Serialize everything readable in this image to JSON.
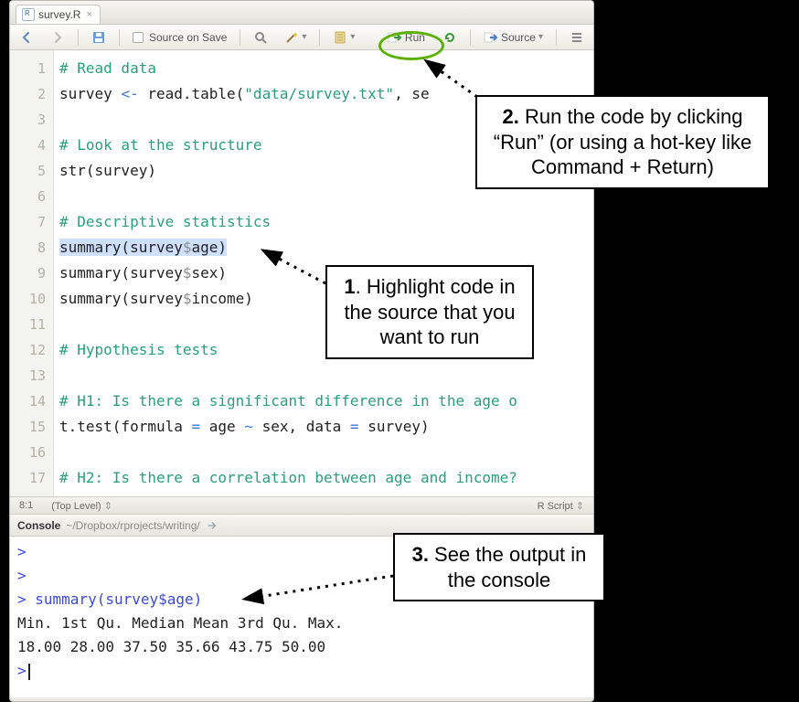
{
  "tab": {
    "filename": "survey.R"
  },
  "toolbar": {
    "source_on_save": "Source on Save",
    "run": "Run",
    "source": "Source"
  },
  "code": {
    "lines": [
      {
        "n": 1,
        "type": "comment",
        "text": "# Read data"
      },
      {
        "n": 2,
        "type": "code",
        "segments": [
          "survey ",
          {
            "op": "<-"
          },
          " read.table(",
          {
            "str": "\"data/survey.txt\""
          },
          ", se"
        ]
      },
      {
        "n": 3,
        "type": "blank"
      },
      {
        "n": 4,
        "type": "comment",
        "text": "# Look at the structure"
      },
      {
        "n": 5,
        "type": "code",
        "segments": [
          "str(survey)"
        ]
      },
      {
        "n": 6,
        "type": "blank"
      },
      {
        "n": 7,
        "type": "comment",
        "text": "# Descriptive statistics"
      },
      {
        "n": 8,
        "type": "code",
        "selected": true,
        "segments": [
          "summary(survey",
          {
            "d": "$"
          },
          "age)"
        ]
      },
      {
        "n": 9,
        "type": "code",
        "segments": [
          "summary(survey",
          {
            "d": "$"
          },
          "sex)"
        ]
      },
      {
        "n": 10,
        "type": "code",
        "segments": [
          "summary(survey",
          {
            "d": "$"
          },
          "income)"
        ]
      },
      {
        "n": 11,
        "type": "blank"
      },
      {
        "n": 12,
        "type": "comment",
        "text": "# Hypothesis tests"
      },
      {
        "n": 13,
        "type": "blank"
      },
      {
        "n": 14,
        "type": "comment",
        "text": "# H1: Is there a significant difference in the age o"
      },
      {
        "n": 15,
        "type": "code",
        "segments": [
          "t.test(formula ",
          {
            "op": "="
          },
          " age ",
          {
            "op": "~"
          },
          " sex, data ",
          {
            "op": "="
          },
          " survey)"
        ]
      },
      {
        "n": 16,
        "type": "blank"
      },
      {
        "n": 17,
        "type": "comment",
        "text": "# H2: Is there a correlation between age and income?"
      }
    ]
  },
  "status": {
    "cursor": "8:1",
    "scope": "(Top Level)",
    "lang": "R Script"
  },
  "console": {
    "title": "Console",
    "path": "~/Dropbox/rprojects/writing/",
    "call": "summary(survey$age)",
    "header": "   Min. 1st Qu.  Median    Mean 3rd Qu.    Max.",
    "values": "  18.00   28.00   37.50   35.66   43.75   50.00"
  },
  "callouts": {
    "c1": "1. Highlight code in the source that you want to run",
    "c2": "2. Run the code by clicking “Run” (or using a hot-key like Command + Return)",
    "c3": "3. See the output in the console"
  }
}
